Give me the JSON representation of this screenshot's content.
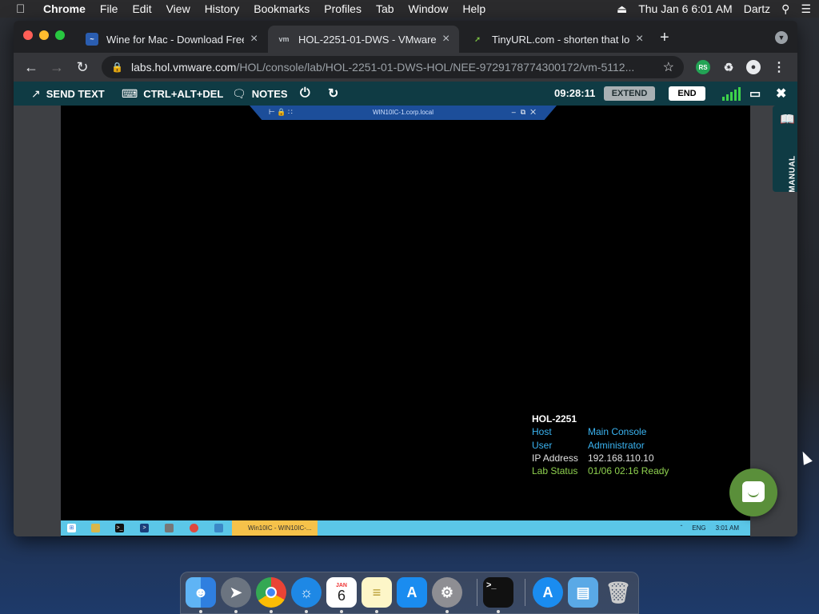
{
  "menubar": {
    "app": "Chrome",
    "items": [
      "File",
      "Edit",
      "View",
      "History",
      "Bookmarks",
      "Profiles",
      "Tab",
      "Window",
      "Help"
    ],
    "clock": "Thu Jan 6  6:01 AM",
    "user": "Dartz"
  },
  "browser": {
    "tabs": [
      {
        "title": "Wine for Mac - Download Free",
        "favicon": "wine-icon",
        "active": false
      },
      {
        "title": "HOL-2251-01-DWS - VMware L",
        "favicon": "vm",
        "active": true
      },
      {
        "title": "TinyURL.com - shorten that lon",
        "favicon": "tinyurl-icon",
        "active": false
      }
    ],
    "url_host": "labs.hol.vmware.com",
    "url_path": "/HOL/console/lab/HOL-2251-01-DWS-HOL/NEE-9729178774300172/vm-5112..."
  },
  "hol_toolbar": {
    "send_text": "SEND TEXT",
    "ctrl_alt_del": "CTRL+ALT+DEL",
    "notes": "NOTES",
    "timer": "09:28:11",
    "extend": "EXTEND",
    "end": "END"
  },
  "rdp_bar": {
    "title": "WIN10IC-1.corp.local"
  },
  "lab_info": {
    "heading": "HOL-2251",
    "rows": [
      {
        "key": "Host",
        "value": "Main Console"
      },
      {
        "key": "User",
        "value": "Administrator"
      },
      {
        "key": "IP Address",
        "value": "192.168.110.10"
      },
      {
        "key": "Lab Status",
        "value": "01/06 02:16 Ready"
      }
    ]
  },
  "win_taskbar": {
    "task": "Win10IC - WIN10IC-...",
    "lang": "ENG",
    "time": "3:01 AM"
  },
  "manual_tab": {
    "label": "MANUAL"
  },
  "dock": {
    "calendar_month": "JAN",
    "calendar_day": "6"
  },
  "colors": {
    "hol_bar": "#0f3b44",
    "win_taskbar": "#5bc7e8",
    "lab_blue": "#3ab4f2",
    "lab_green": "#8fd14f",
    "chat": "#5a8f3a"
  }
}
